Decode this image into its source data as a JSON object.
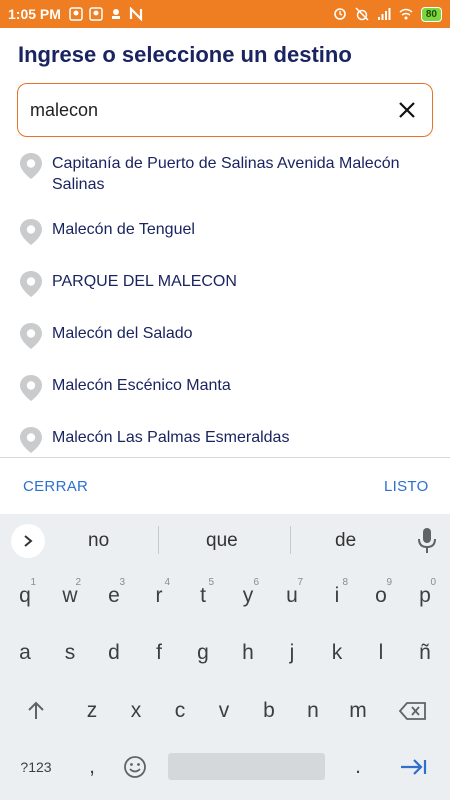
{
  "status_bar": {
    "time": "1:05 PM",
    "battery": "80",
    "left_icons": [
      "notification-icon",
      "notification-icon",
      "notification-icon",
      "n-app-icon"
    ],
    "right_icons": [
      "sync-icon",
      "alarm-icon",
      "signal-icon",
      "wifi-icon"
    ]
  },
  "page": {
    "title": "Ingrese o seleccione un destino"
  },
  "search": {
    "value": "malecon",
    "clear_icon": "close-icon",
    "border_color": "#e8722a"
  },
  "results": [
    {
      "label": "Capitanía de Puerto de Salinas Avenida Malecón Salinas"
    },
    {
      "label": "Malecón de Tenguel"
    },
    {
      "label": "PARQUE DEL MALECON"
    },
    {
      "label": "Malecón del Salado"
    },
    {
      "label": "Malecón Escénico  Manta"
    },
    {
      "label": "Malecón Las Palmas  Esmeraldas"
    }
  ],
  "footer": {
    "close_label": "CERRAR",
    "done_label": "LISTO"
  },
  "keyboard": {
    "suggestions": [
      "no",
      "que",
      "de"
    ],
    "row1": [
      {
        "k": "q",
        "h": "1"
      },
      {
        "k": "w",
        "h": "2"
      },
      {
        "k": "e",
        "h": "3"
      },
      {
        "k": "r",
        "h": "4"
      },
      {
        "k": "t",
        "h": "5"
      },
      {
        "k": "y",
        "h": "6"
      },
      {
        "k": "u",
        "h": "7"
      },
      {
        "k": "i",
        "h": "8"
      },
      {
        "k": "o",
        "h": "9"
      },
      {
        "k": "p",
        "h": "0"
      }
    ],
    "row2": [
      "a",
      "s",
      "d",
      "f",
      "g",
      "h",
      "j",
      "k",
      "l",
      "ñ"
    ],
    "row3": [
      "z",
      "x",
      "c",
      "v",
      "b",
      "n",
      "m"
    ],
    "symbols_label": "?123",
    "comma": ",",
    "period": "."
  },
  "colors": {
    "status_bar": "#ef7d22",
    "title": "#1a2460",
    "footer_text": "#2e6fd0",
    "keyboard_bg": "#eceff1"
  }
}
